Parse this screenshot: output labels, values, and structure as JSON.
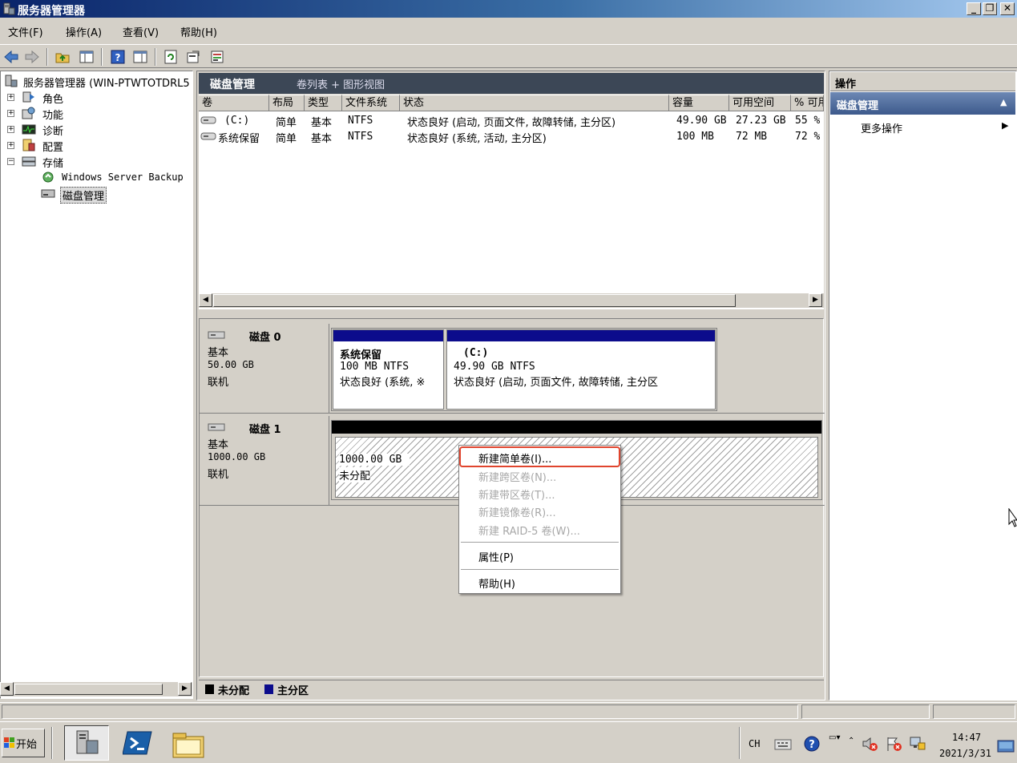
{
  "window": {
    "title": "服务器管理器"
  },
  "caption_buttons": {
    "minimize": "_",
    "restore": "❐",
    "close": "✕"
  },
  "menu": {
    "items": [
      "文件(F)",
      "操作(A)",
      "查看(V)",
      "帮助(H)"
    ]
  },
  "tree": {
    "root": "服务器管理器 (WIN-PTWTOTDRL5",
    "items": [
      "角色",
      "功能",
      "诊断",
      "配置",
      "存储"
    ],
    "storage_children": [
      "Windows Server Backup",
      "磁盘管理"
    ]
  },
  "center": {
    "title": "磁盘管理",
    "view": "卷列表 + 图形视图"
  },
  "volume_table": {
    "headers": [
      "卷",
      "布局",
      "类型",
      "文件系统",
      "状态",
      "容量",
      "可用空间",
      "% 可用"
    ],
    "rows": [
      {
        "volume": "(C:)",
        "layout": "简单",
        "type": "基本",
        "fs": "NTFS",
        "status": "状态良好 (启动, 页面文件, 故障转储, 主分区)",
        "capacity": "49.90 GB",
        "free": "27.23 GB",
        "pct": "55 %"
      },
      {
        "volume": "系统保留",
        "layout": "简单",
        "type": "基本",
        "fs": "NTFS",
        "status": "状态良好 (系统, 活动, 主分区)",
        "capacity": "100 MB",
        "free": "72 MB",
        "pct": "72 %"
      }
    ]
  },
  "disks": [
    {
      "name": "磁盘 0",
      "type": "基本",
      "size": "50.00 GB",
      "state": "联机",
      "partitions": [
        {
          "name": "系统保留",
          "size": "100 MB NTFS",
          "status": "状态良好 (系统, ※"
        },
        {
          "name": "(C:)",
          "size": "49.90 GB NTFS",
          "status": "状态良好 (启动, 页面文件, 故障转储, 主分区"
        }
      ]
    },
    {
      "name": "磁盘 1",
      "type": "基本",
      "size": "1000.00 GB",
      "state": "联机",
      "partitions": [
        {
          "size": "1000.00 GB",
          "status": "未分配"
        }
      ]
    }
  ],
  "legend": {
    "unallocated": "未分配",
    "primary": "主分区",
    "unallocated_color": "#000000",
    "primary_color": "#0c0c8c"
  },
  "actions": {
    "header": "操作",
    "section": "磁盘管理",
    "more": "更多操作"
  },
  "context_menu": {
    "items": [
      {
        "label": "新建简单卷(I)...",
        "enabled": true,
        "highlighted": true
      },
      {
        "label": "新建跨区卷(N)...",
        "enabled": false
      },
      {
        "label": "新建带区卷(T)...",
        "enabled": false
      },
      {
        "label": "新建镜像卷(R)...",
        "enabled": false
      },
      {
        "label": "新建 RAID-5 卷(W)...",
        "enabled": false
      },
      {
        "label": "属性(P)",
        "enabled": true
      },
      {
        "label": "帮助(H)",
        "enabled": true
      }
    ],
    "highlight_color": "#e0452e"
  },
  "taskbar": {
    "start": "开始",
    "tray": {
      "lang": "CH",
      "time": "14:47",
      "date": "2021/3/31"
    }
  }
}
